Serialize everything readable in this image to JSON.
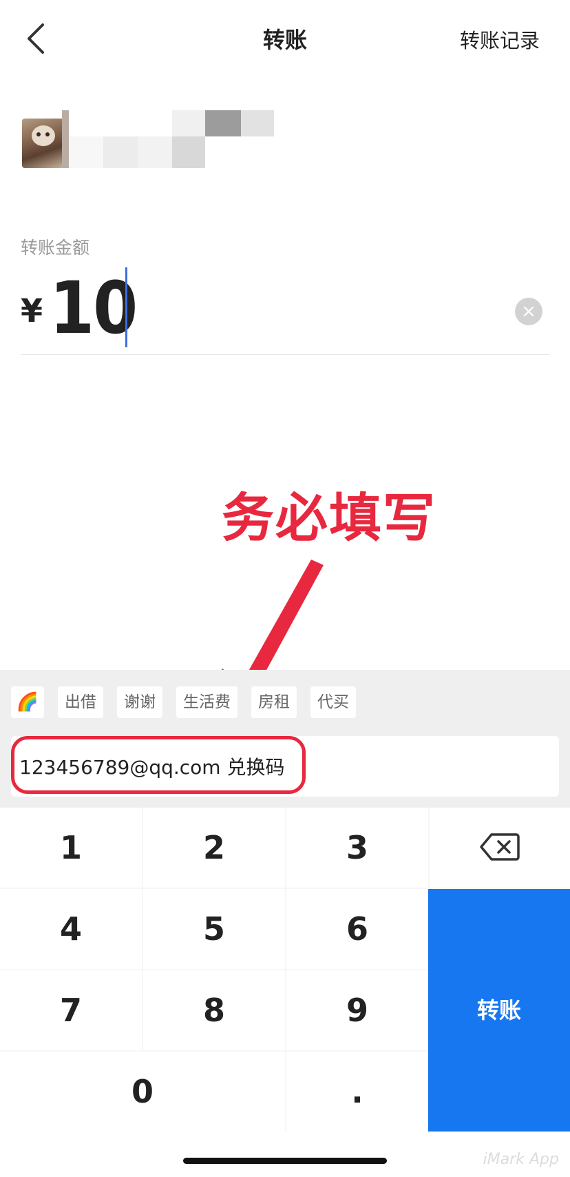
{
  "header": {
    "back_icon": "chevron-left-icon",
    "title": "转账",
    "records_link": "转账记录"
  },
  "recipient": {
    "avatar_icon": "cat-avatar"
  },
  "amount": {
    "label": "转账金额",
    "currency_symbol": "¥",
    "value": "10",
    "clear_icon": "×"
  },
  "annotation": {
    "text": "务必填写",
    "color": "#e8283e"
  },
  "remark": {
    "chips": [
      "🌈",
      "出借",
      "谢谢",
      "生活费",
      "房租",
      "代买"
    ],
    "value": "123456789@qq.com 兑换码"
  },
  "keypad": {
    "keys": [
      "1",
      "2",
      "3",
      "4",
      "5",
      "6",
      "7",
      "8",
      "9",
      "0",
      "."
    ],
    "delete_icon": "backspace-icon",
    "submit_label": "转账",
    "accent": "#1677f0"
  },
  "watermark": "iMark App"
}
